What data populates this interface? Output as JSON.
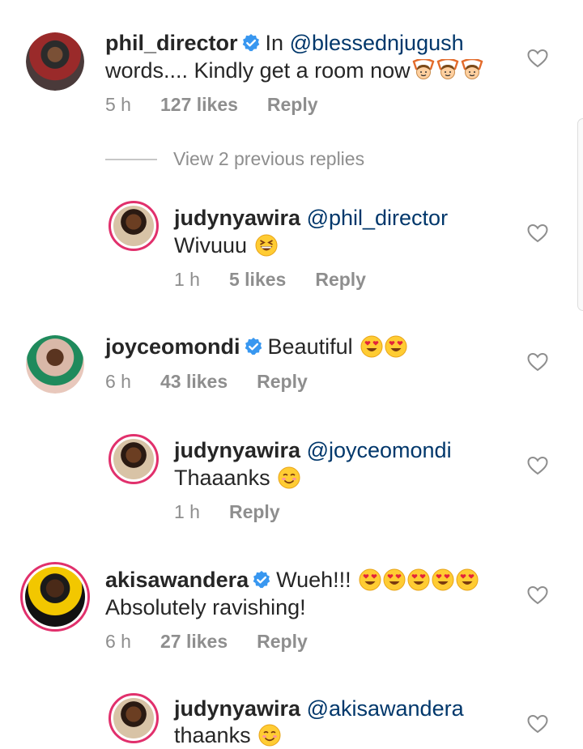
{
  "comments": [
    {
      "username": "phil_director",
      "verified": true,
      "text_before_mention": "In ",
      "mention": "@blessednjugush",
      "line2_text": "words.... Kindly get a room now",
      "emojis": [
        "person-gesturing-ok",
        "person-gesturing-ok",
        "person-gesturing-ok"
      ],
      "time": "5 h",
      "likes": "127 likes",
      "reply_label": "Reply"
    },
    {
      "username": "judynyawira",
      "mention": "@phil_director",
      "line2_text": "Wivuuu",
      "emojis": [
        "grinning-squinting-face"
      ],
      "time": "1 h",
      "likes": "5 likes",
      "reply_label": "Reply"
    },
    {
      "username": "joyceomondi",
      "verified": true,
      "text": "Beautiful",
      "emojis": [
        "heart-eyes",
        "heart-eyes"
      ],
      "time": "6 h",
      "likes": "43 likes",
      "reply_label": "Reply"
    },
    {
      "username": "judynyawira",
      "mention": "@joyceomondi",
      "line2_text": "Thaaanks",
      "emojis": [
        "smiling-blush-face"
      ],
      "time": "1 h",
      "reply_label": "Reply"
    },
    {
      "username": "akisawandera",
      "verified": true,
      "text": "Wueh!!!",
      "emojis": [
        "heart-eyes",
        "heart-eyes",
        "heart-eyes",
        "heart-eyes",
        "heart-eyes"
      ],
      "line2_text": "Absolutely ravishing!",
      "time": "6 h",
      "likes": "27 likes",
      "reply_label": "Reply"
    },
    {
      "username": "judynyawira",
      "mention": "@akisawandera",
      "line2_text": "thaanks",
      "emojis": [
        "smiling-blush-face"
      ]
    }
  ],
  "view_previous_replies": "View 2 previous replies",
  "colors": {
    "mention": "#00376b",
    "meta": "#8e8e8e",
    "verified": "#3897f0",
    "story_ring": "#e1306c"
  }
}
